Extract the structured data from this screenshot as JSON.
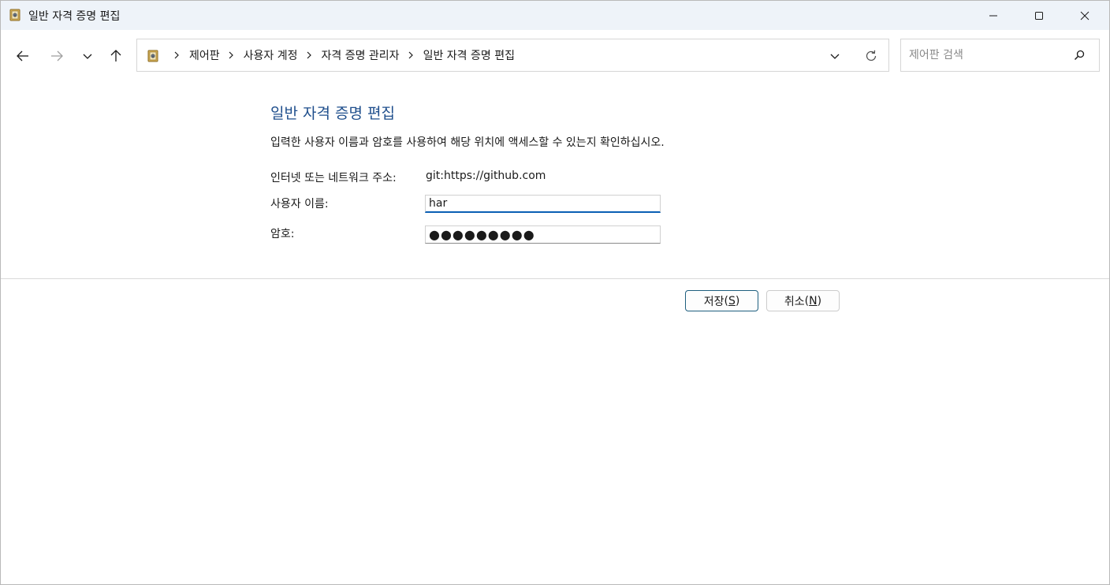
{
  "window": {
    "title": "일반 자격 증명 편집"
  },
  "address_bar": {
    "breadcrumbs": [
      "제어판",
      "사용자 계정",
      "자격 증명 관리자",
      "일반 자격 증명 편집"
    ]
  },
  "search": {
    "placeholder": "제어판 검색"
  },
  "content": {
    "heading": "일반 자격 증명 편집",
    "instruction": "입력한 사용자 이름과 암호를 사용하여 해당 위치에 액세스할 수 있는지 확인하십시오.",
    "address_label": "인터넷 또는 네트워크 주소:",
    "address_value": "git:https://github.com",
    "username_label": "사용자 이름:",
    "username_value": "har",
    "password_label": "암호:",
    "password_value": "●●●●●●●●●"
  },
  "buttons": {
    "save_label": "저장",
    "save_mnemonic": "S",
    "cancel_label": "취소",
    "cancel_mnemonic": "N"
  },
  "icons": {
    "app": "credential-vault-icon",
    "back": "arrow-left-icon",
    "forward": "arrow-right-icon",
    "recent": "chevron-down-icon",
    "up": "arrow-up-icon",
    "breadcrumb_separator": "chevron-right-icon",
    "address_dropdown": "chevron-down-icon",
    "refresh": "refresh-icon",
    "search": "search-icon",
    "minimize": "minimize-icon",
    "maximize": "maximize-icon",
    "close": "close-icon"
  },
  "colors": {
    "heading": "#1e4e8c",
    "titlebar": "#eef3f9",
    "focus_underline": "#0a5fb4"
  }
}
